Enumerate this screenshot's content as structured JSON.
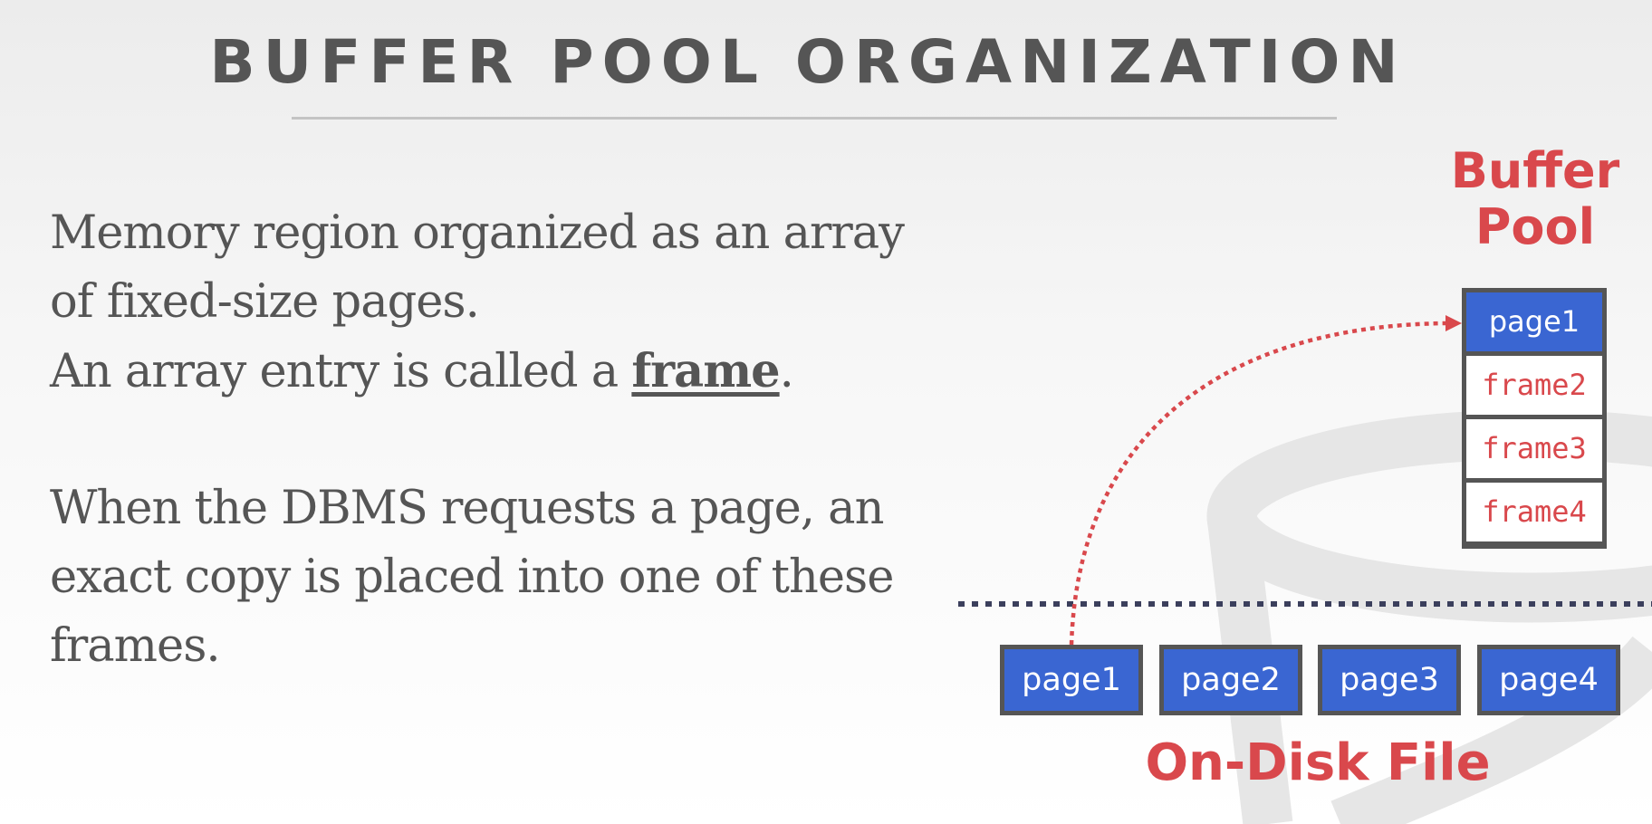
{
  "slide": {
    "title": "BUFFER POOL ORGANIZATION",
    "paragraph1": {
      "line1": "Memory region organized as an array",
      "line2": "of fixed-size pages.",
      "line3_before": "An array entry is called a ",
      "term": "frame",
      "line3_after": "."
    },
    "paragraph2": {
      "line1": "When the DBMS requests a page, an",
      "line2": "exact copy is placed into one of these",
      "line3": "frames."
    }
  },
  "diagram": {
    "buffer_pool_label_line1": "Buffer",
    "buffer_pool_label_line2": "Pool",
    "frames": [
      "page1",
      "frame2",
      "frame3",
      "frame4"
    ],
    "disk_label": "On-Disk File",
    "disk_pages": [
      "page1",
      "page2",
      "page3",
      "page4"
    ]
  },
  "colors": {
    "accent_red": "#d9484c",
    "page_blue": "#3a66d2",
    "box_border": "#555555",
    "dotted_divider": "#3b3f5c",
    "text_gray": "#555555"
  }
}
